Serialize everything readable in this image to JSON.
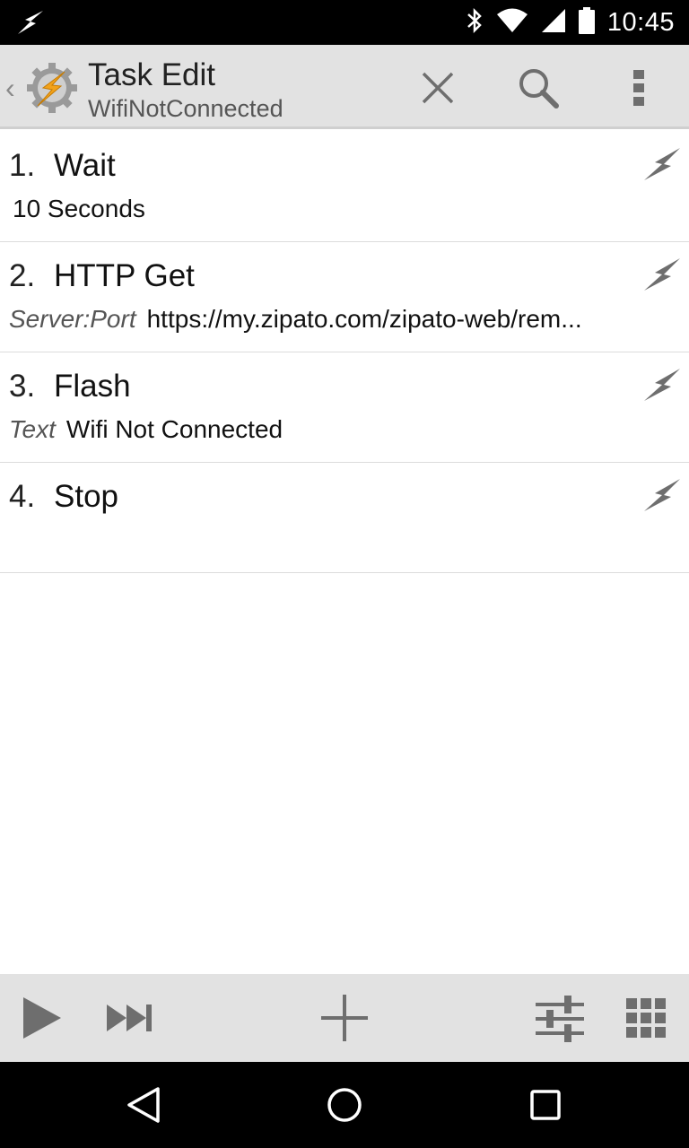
{
  "status_bar": {
    "time": "10:45",
    "icons": [
      "bolt-icon",
      "bluetooth-icon",
      "wifi-icon",
      "cell-signal-icon",
      "battery-icon"
    ]
  },
  "action_bar": {
    "title": "Task Edit",
    "subtitle": "WifiNotConnected",
    "back_glyph": "‹",
    "icons": [
      "app-logo-icon",
      "close-icon",
      "search-icon",
      "overflow-menu-icon"
    ]
  },
  "actions": [
    {
      "number": "1.",
      "name": "Wait",
      "param_label": "",
      "param_value": "10 Seconds"
    },
    {
      "number": "2.",
      "name": "HTTP Get",
      "param_label": "Server:Port",
      "param_value": "https://my.zipato.com/zipato-web/rem..."
    },
    {
      "number": "3.",
      "name": "Flash",
      "param_label": "Text",
      "param_value": "Wifi Not Connected"
    },
    {
      "number": "4.",
      "name": "Stop",
      "param_label": "",
      "param_value": ""
    }
  ],
  "toolbar": {
    "icons": [
      "play-icon",
      "skip-next-icon",
      "add-icon",
      "sliders-icon",
      "grid-icon"
    ]
  },
  "nav_bar": {
    "icons": [
      "back-triangle-icon",
      "home-circle-icon",
      "recents-square-icon"
    ]
  },
  "colors": {
    "action_bar_bg": "#e2e2e2",
    "status_bar_bg": "#000000",
    "icon_gray": "#6e6e6e",
    "logo_orange": "#f2a21b"
  }
}
